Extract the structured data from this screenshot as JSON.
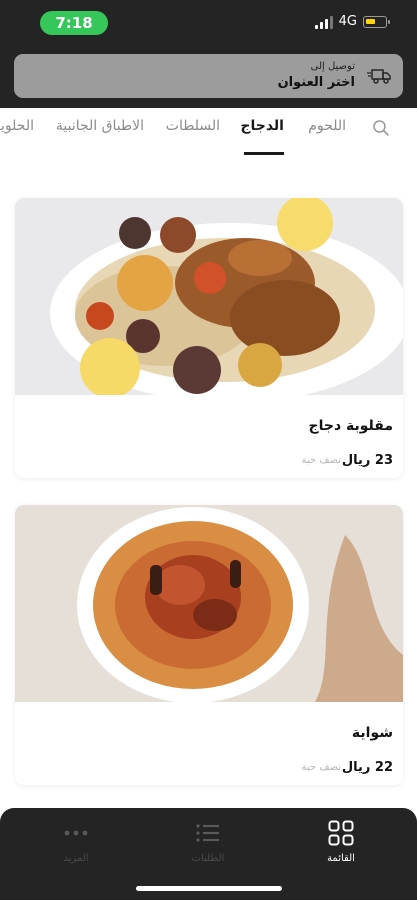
{
  "status_bar": {
    "time": "7:18",
    "network": "4G"
  },
  "address": {
    "caption": "توصيل إلى",
    "value": "اختر العنوان"
  },
  "tabs": [
    {
      "label": "اللحوم"
    },
    {
      "label": "الدجاج"
    },
    {
      "label": "السلطات"
    },
    {
      "label": "الاطباق الجانبية"
    },
    {
      "label": "الحلويات"
    }
  ],
  "products": [
    {
      "name": "مقلوبة دجاج",
      "price": "23 ريال",
      "portion": "نصف حبة"
    },
    {
      "name": "شواية",
      "price": "22 ريال",
      "portion": "نصف حبة"
    }
  ],
  "bottom_nav": [
    {
      "label": "القائمة"
    },
    {
      "label": "الطلبات"
    },
    {
      "label": "المزيد"
    }
  ],
  "colors": {
    "accent_green": "#35c759",
    "dark_bar": "#242424"
  }
}
